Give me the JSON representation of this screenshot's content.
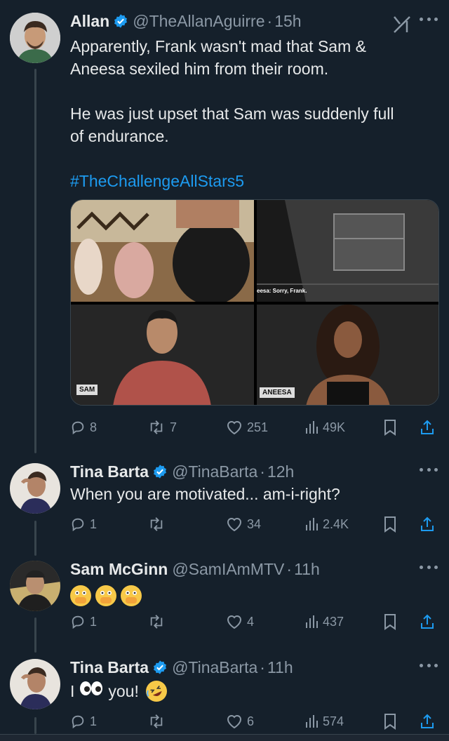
{
  "colors": {
    "background": "#15202b",
    "text": "#e7e9ea",
    "muted": "#8b98a5",
    "accent": "#1d9bf0",
    "verified": "#1d9bf0"
  },
  "tweets": [
    {
      "name": "Allan",
      "handle": "@TheAllanAguirre",
      "time": "15h",
      "text_lines": [
        "Apparently, Frank wasn't mad that Sam &",
        "Aneesa sexiled him from their room.",
        "",
        "He was just upset that Sam was suddenly full",
        "of endurance."
      ],
      "hashtag": "#TheChallengeAllStars5",
      "media": {
        "caption": "eesa: Sorry, Frank.",
        "label_sam": "SAM",
        "label_aneesa": "ANEESA"
      },
      "stats": {
        "replies": "8",
        "retweets": "7",
        "likes": "251",
        "views": "49K"
      }
    },
    {
      "name": "Tina Barta",
      "handle": "@TinaBarta",
      "time": "12h",
      "text": "When you are motivated... am-i-right?",
      "stats": {
        "replies": "1",
        "retweets": "",
        "likes": "34",
        "views": "2.4K"
      }
    },
    {
      "name": "Sam McGinn",
      "handle": "@SamIAmMTV",
      "time": "11h",
      "emojis": [
        "face-with-open-eyes-and-hand-over-mouth",
        "face-with-open-eyes-and-hand-over-mouth",
        "face-with-open-eyes-and-hand-over-mouth"
      ],
      "stats": {
        "replies": "1",
        "retweets": "",
        "likes": "4",
        "views": "437"
      }
    },
    {
      "name": "Tina Barta",
      "handle": "@TinaBarta",
      "time": "11h",
      "text_before": "I",
      "text_after": "you!",
      "emojis": [
        "eyes",
        "rolling-on-the-floor-laughing"
      ],
      "stats": {
        "replies": "1",
        "retweets": "",
        "likes": "6",
        "views": "574"
      }
    }
  ],
  "separator": "·"
}
